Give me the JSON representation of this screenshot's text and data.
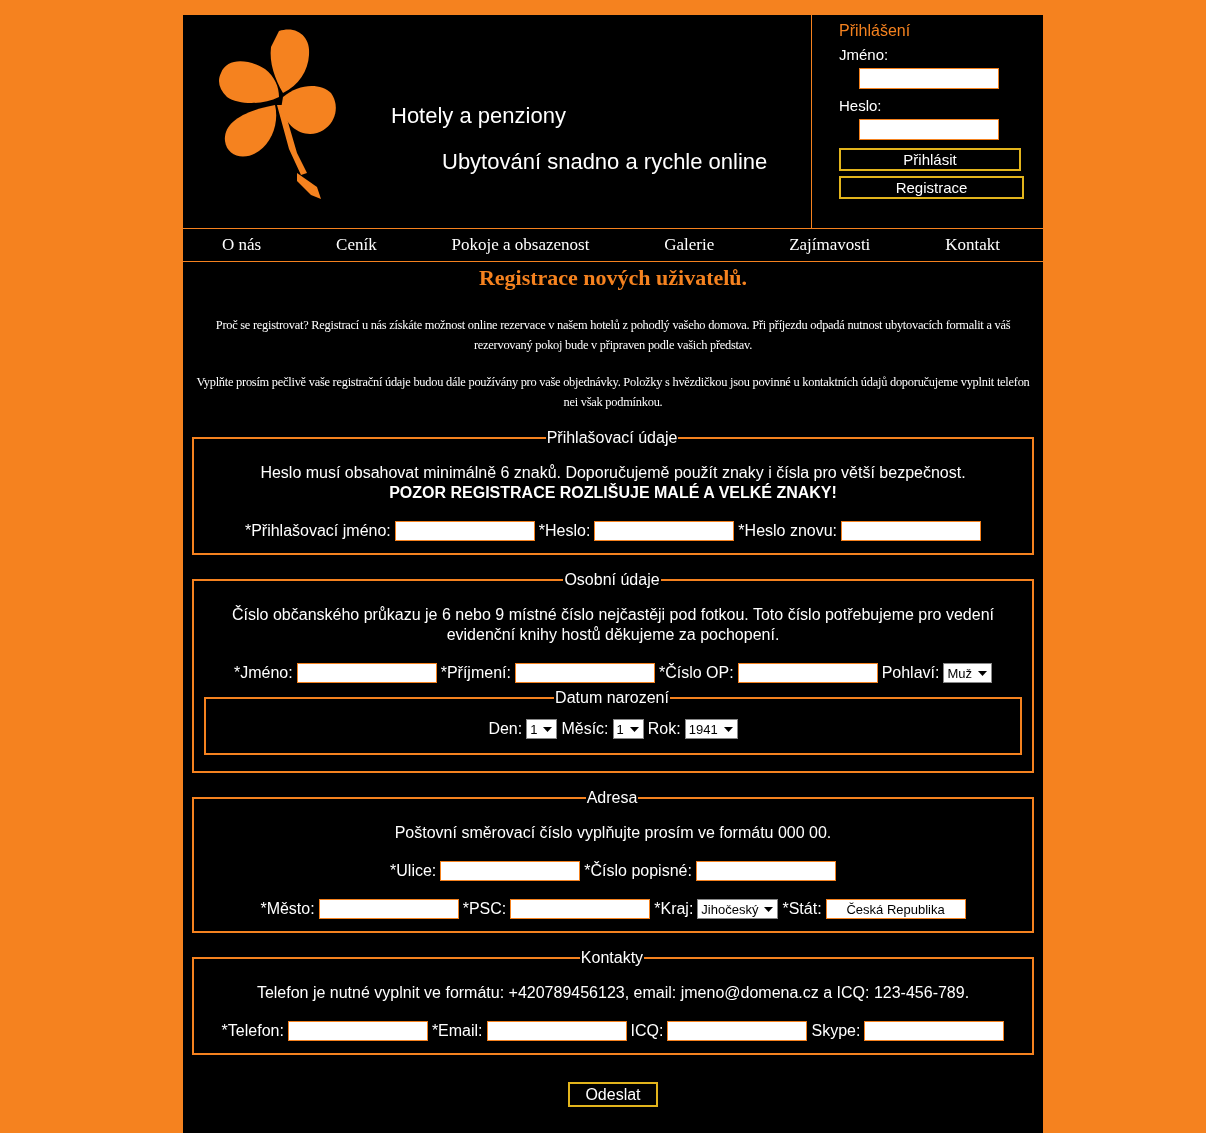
{
  "header": {
    "title": "Hotely a penziony",
    "subtitle": "Ubytování snadno a rychle online"
  },
  "login": {
    "title": "Přihlášení",
    "fields": [
      {
        "label": "Jméno:"
      },
      {
        "label": "Heslo:"
      }
    ],
    "buttons": [
      "Přihlásit",
      "Registrace"
    ]
  },
  "nav": [
    "O nás",
    "Ceník",
    "Pokoje a obsazenost",
    "Galerie",
    "Zajímavosti",
    "Kontakt"
  ],
  "page_title": "Registrace nových uživatelů.",
  "intro": [
    "Proč se registrovat? Registrací u nás získáte možnost online rezervace v našem hotelů z pohodlý vašeho domova. Při příjezdu odpadá nutnost ubytovacích formalit a váš rezervovaný pokoj bude v připraven podle vašich představ.",
    "Vyplňte prosím pečlivě vaše registrační údaje budou dále používány pro vaše objednávky. Položky s hvězdičkou jsou povinné u kontaktních údajů doporučujeme vyplnit telefon nei však podmínkou."
  ],
  "sections": [
    {
      "legend": "Přihlašovací údaje",
      "note": "Heslo musí obsahovat minimálně 6 znaků. Doporučujemě použít znaky i čísla pro větší bezpečnost.",
      "warning": "POZOR REGISTRACE ROZLIŠUJE MALÉ A VELKÉ ZNAKY!",
      "rows": [
        [
          {
            "label": "*Přihlašovací jméno:",
            "kind": "text"
          },
          {
            "label": "*Heslo:",
            "kind": "text"
          },
          {
            "label": "*Heslo znovu:",
            "kind": "text"
          }
        ]
      ]
    },
    {
      "legend": "Osobní údaje",
      "note": "Číslo občanského průkazu je 6 nebo 9 místné číslo nejčastěji pod fotkou. Toto číslo potřebujeme pro vedení evidenční knihy hostů děkujeme za pochopení.",
      "rows": [
        [
          {
            "label": "*Jméno:",
            "kind": "text"
          },
          {
            "label": "*Příjmení:",
            "kind": "text"
          },
          {
            "label": "*Číslo OP:",
            "kind": "text"
          },
          {
            "label": "Pohlaví:",
            "kind": "select",
            "value": "Muž"
          }
        ]
      ],
      "subsections": [
        {
          "legend": "Datum narození",
          "rows": [
            [
              {
                "label": "Den:",
                "kind": "select",
                "value": "1"
              },
              {
                "label": "Měsíc:",
                "kind": "select",
                "value": "1"
              },
              {
                "label": "Rok:",
                "kind": "select",
                "value": "1941"
              }
            ]
          ]
        }
      ]
    },
    {
      "legend": "Adresa",
      "note": "Poštovní směrovací číslo vyplňujte prosím ve formátu 000 00.",
      "rows": [
        [
          {
            "label": "*Ulice:",
            "kind": "text"
          },
          {
            "label": "*Číslo popisné:",
            "kind": "text"
          }
        ],
        [
          {
            "label": "*Město:",
            "kind": "text"
          },
          {
            "label": "*PSC:",
            "kind": "text"
          },
          {
            "label": "*Kraj:",
            "kind": "select",
            "value": "Jihočeský"
          },
          {
            "label": "*Stát:",
            "kind": "text",
            "value": "Česká Republika"
          }
        ]
      ]
    },
    {
      "legend": "Kontakty",
      "note": "Telefon je nutné vyplnit ve formátu: +420789456123, email: jmeno@domena.cz a ICQ: 123-456-789.",
      "rows": [
        [
          {
            "label": "*Telefon:",
            "kind": "text"
          },
          {
            "label": "*Email:",
            "kind": "text"
          },
          {
            "label": "ICQ:",
            "kind": "text"
          },
          {
            "label": "Skype:",
            "kind": "text"
          }
        ]
      ]
    }
  ],
  "submit": "Odeslat"
}
